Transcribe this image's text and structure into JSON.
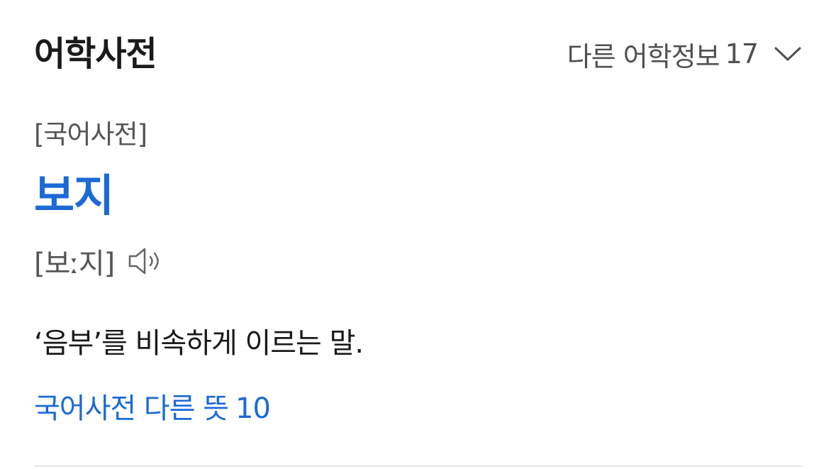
{
  "header": {
    "title": "어학사전",
    "more_label": "다른 어학정보",
    "more_count": "17",
    "more_icon": "chevron-down-icon"
  },
  "entry": {
    "source": "[국어사전]",
    "headword": "보지",
    "pronunciation": "[보ː지]",
    "audio_icon": "speaker-icon",
    "definition": "‘음부’를 비속하게 이르는 말.",
    "other_meanings_label": "국어사전 다른 뜻",
    "other_meanings_count": "10"
  },
  "colors": {
    "link": "#1b6ad6",
    "text": "#1a1a1a",
    "muted": "#555555"
  }
}
